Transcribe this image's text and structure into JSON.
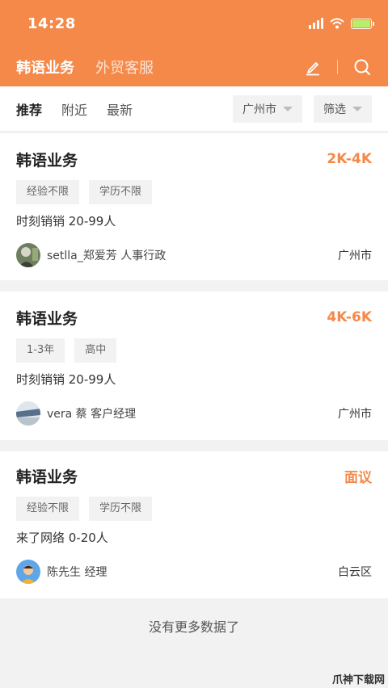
{
  "status": {
    "time": "14:28"
  },
  "topnav": {
    "tabs": [
      {
        "label": "韩语业务"
      },
      {
        "label": "外贸客服"
      }
    ]
  },
  "filters": {
    "tabs": [
      {
        "label": "推荐"
      },
      {
        "label": "附近"
      },
      {
        "label": "最新"
      }
    ],
    "city": "广州市",
    "filter": "筛选"
  },
  "jobs": [
    {
      "title": "韩语业务",
      "salary": "2K-4K",
      "tags": [
        "经验不限",
        "学历不限"
      ],
      "company": "时刻销销   20-99人",
      "recruiter": "setlla_郑爱芳  人事行政",
      "location": "广州市"
    },
    {
      "title": "韩语业务",
      "salary": "4K-6K",
      "tags": [
        "1-3年",
        "高中"
      ],
      "company": "时刻销销   20-99人",
      "recruiter": "vera 蔡  客户经理",
      "location": "广州市"
    },
    {
      "title": "韩语业务",
      "salary": "面议",
      "tags": [
        "经验不限",
        "学历不限"
      ],
      "company": "来了网络   0-20人",
      "recruiter": "陈先生  经理",
      "location": "白云区"
    }
  ],
  "footer": {
    "no_more": "没有更多数据了",
    "watermark": "爪神下载网"
  },
  "colors": {
    "accent": "#f4894a",
    "background": "#f2f2f2"
  }
}
